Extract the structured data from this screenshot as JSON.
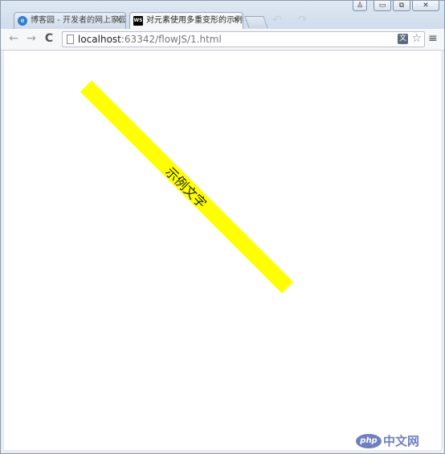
{
  "tabs": [
    {
      "title": "博客园 - 开发者的网上家园",
      "active": false,
      "icon": "globe-icon"
    },
    {
      "title": "对元素使用多重变形的示例",
      "active": true,
      "icon": "webstorm-icon",
      "icon_text": "WS"
    }
  ],
  "window_controls": {
    "minimize": "▭",
    "restore": "⧉",
    "close": "✕",
    "user": "♙"
  },
  "toolbar": {
    "back": "←",
    "forward": "→",
    "reload": "C",
    "url_host": "localhost",
    "url_rest": ":63342/flowJS/1.html",
    "translate": "文",
    "bookmark": "☆",
    "menu": "≡"
  },
  "page": {
    "demo_text": "示例文字",
    "demo_color": "#ffff00"
  },
  "watermark": {
    "logo": "php",
    "text": "中文网"
  }
}
